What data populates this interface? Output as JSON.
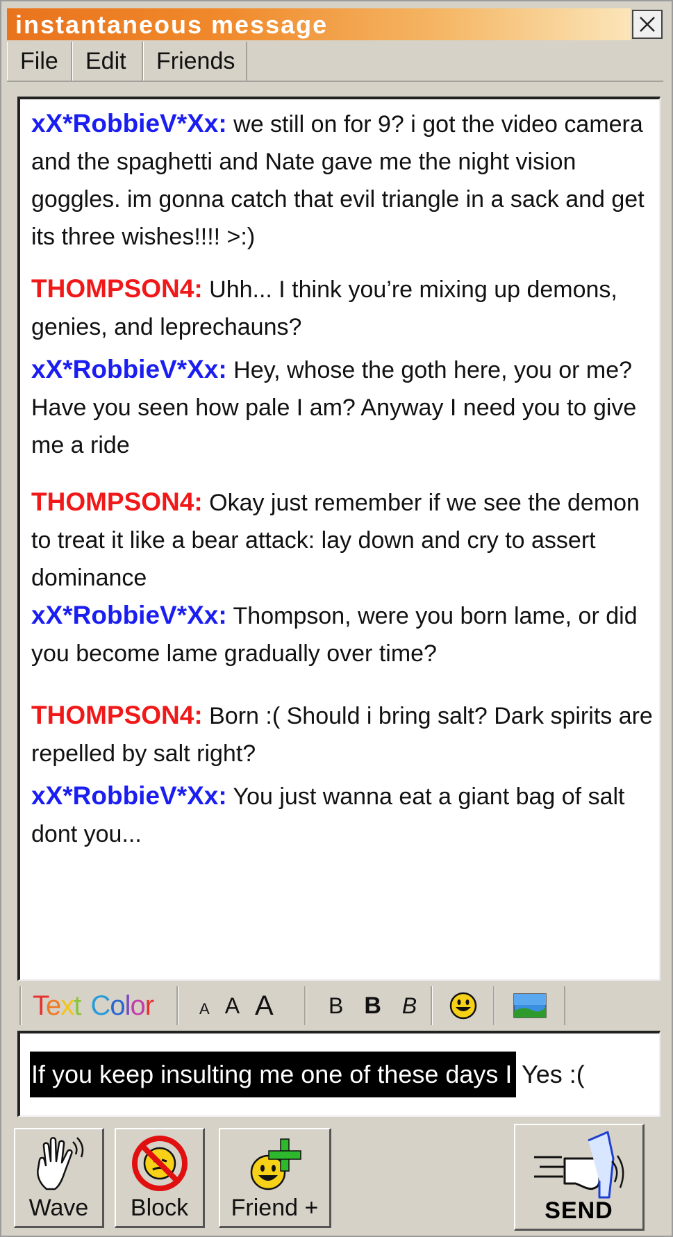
{
  "window": {
    "title": "instantaneous message"
  },
  "menu": [
    {
      "label": "File"
    },
    {
      "label": "Edit"
    },
    {
      "label": "Friends"
    }
  ],
  "chat": {
    "messages": [
      {
        "nick": "xX*RobbieV*Xx:",
        "text": " we still on for 9? i got the video camera and the spaghetti and Nate gave me the night vision goggles. im gonna catch that evil triangle in a sack and get its three wishes!!!! >:)"
      },
      {
        "nick": "THOMPSON4:",
        "text": " Uhh... I think you’re mixing up demons, genies, and leprechauns?"
      },
      {
        "nick": "xX*RobbieV*Xx:",
        "text": " Hey, whose the goth here, you or me? Have you seen how pale I am? Anyway I need you to give me a ride"
      },
      {
        "nick": "THOMPSON4:",
        "text": "  Okay just remember if we see the demon to treat it like a bear attack:  lay down and cry to assert dominance"
      },
      {
        "nick": "xX*RobbieV*Xx:",
        "text": "  Thompson, were you born lame, or did you become lame gradually over time?"
      },
      {
        "nick": "THOMPSON4:",
        "text": " Born :( Should i bring salt? Dark spirits are repelled by salt right?"
      },
      {
        "nick": "xX*RobbieV*Xx:",
        "text": " You just wanna eat a giant bag of salt dont you..."
      }
    ]
  },
  "format_toolbar": {
    "text_color_label": [
      "T",
      "e",
      "x",
      "t",
      " ",
      "C",
      "o",
      "l",
      "o",
      "r"
    ],
    "text_color_colors": [
      "#e8312f",
      "#f07a22",
      "#f2c41c",
      "#8ac43a",
      "#ffffff",
      "#2a9bd8",
      "#2a66cf",
      "#7a4bbf",
      "#c23ea8",
      "#e8312f"
    ],
    "size_small": "A",
    "size_medium": "A",
    "size_large": "A",
    "bold_light": "B",
    "bold_heavy": "B",
    "italic": "B"
  },
  "input": {
    "selected_text": "If you keep insulting me one of these days I",
    "typed_text": "Yes :("
  },
  "buttons": {
    "wave": "Wave",
    "block": "Block",
    "friend": "Friend +",
    "send": "SEND"
  },
  "colors": {
    "robbie_nick": "#1a1ef0",
    "thompson_nick": "#f01818",
    "title_gradient_start": "#e9731d",
    "title_gradient_end": "#fbe5b9"
  }
}
